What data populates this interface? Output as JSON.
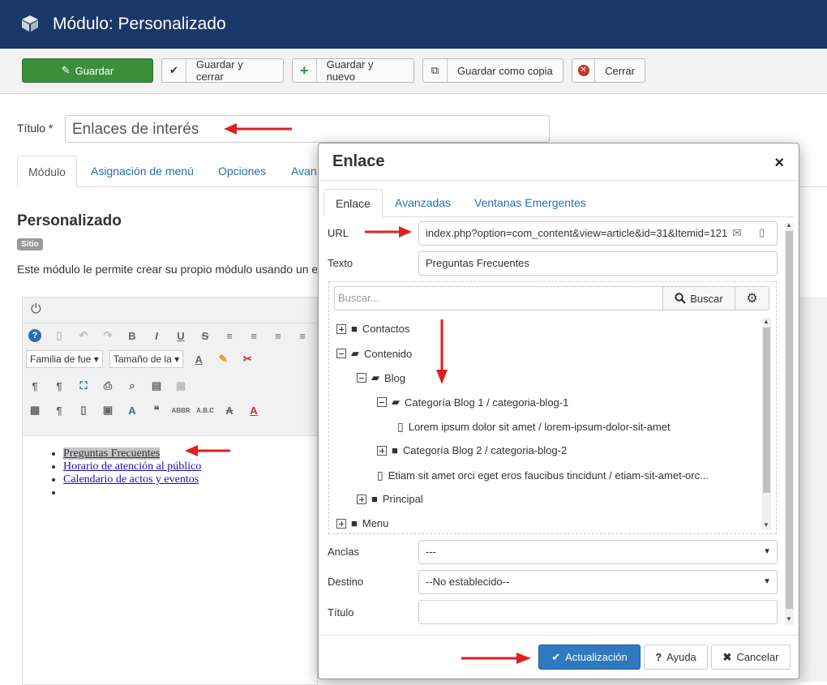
{
  "header": {
    "title": "Módulo: Personalizado"
  },
  "toolbar": {
    "save": "Guardar",
    "save_close": "Guardar y cerrar",
    "save_new": "Guardar y nuevo",
    "save_copy": "Guardar como copia",
    "close": "Cerrar"
  },
  "form": {
    "title_label": "Título *",
    "title_value": "Enlaces de interés"
  },
  "page_tabs": [
    "Módulo",
    "Asignación de menú",
    "Opciones",
    "Avan"
  ],
  "module": {
    "heading": "Personalizado",
    "badge": "Sitio",
    "description": "Este módulo le permite crear su propio módulo usando un e"
  },
  "editor": {
    "font_family": "Familia de fue",
    "font_size": "Tamaño de la",
    "list": [
      "Preguntas Frecuentes",
      "Horario de atención al público",
      "Calendario de actos y eventos",
      ""
    ]
  },
  "modal": {
    "title": "Enlace",
    "close": "×",
    "tabs": [
      "Enlace",
      "Avanzadas",
      "Ventanas Emergentes"
    ],
    "url_label": "URL",
    "url_value": "index.php?option=com_content&view=article&id=31&Itemid=121",
    "text_label": "Texto",
    "text_value": "Preguntas Frecuentes",
    "search_placeholder": "Buscar...",
    "search_button": "Buscar",
    "tree": [
      "Contactos",
      "Contenido",
      "Blog",
      "Categoría Blog 1 / categoria-blog-1",
      "Lorem ipsum dolor sit amet / lorem-ipsum-dolor-sit-amet",
      "Categoría Blog 2 / categoria-blog-2",
      "Etiam sit amet orci eget eros faucibus tincidunt / etiam-sit-amet-orc...",
      "Principal",
      "Menu"
    ],
    "anchors_label": "Anclas",
    "anchors_value": "---",
    "target_label": "Destino",
    "target_value": "--No establecido--",
    "title_label": "Título",
    "title_value": "",
    "update_button": "Actualización",
    "help_button": "Ayuda",
    "cancel_button": "Cancelar"
  },
  "colors": {
    "header_bg": "#1a3867",
    "save_green": "#3b8f3b",
    "primary_blue": "#2f79c0",
    "annotation_red": "#e02020"
  }
}
